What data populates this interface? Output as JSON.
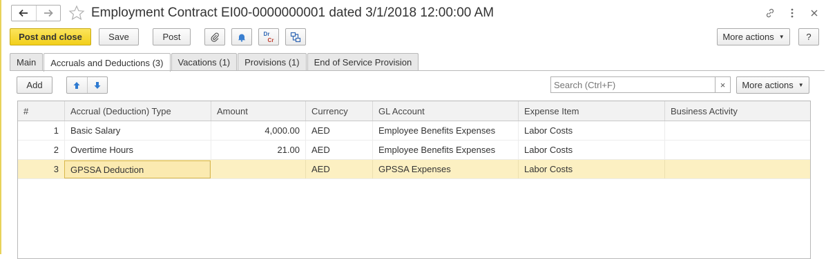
{
  "window": {
    "title": "Employment Contract EI00-0000000001 dated 3/1/2018 12:00:00 AM"
  },
  "toolbar": {
    "post_and_close": "Post and close",
    "save": "Save",
    "post": "Post",
    "more_actions": "More actions",
    "help": "?",
    "dr_label": "Dr",
    "cr_label": "Cr"
  },
  "tabs": [
    {
      "label": "Main"
    },
    {
      "label": "Accruals and Deductions (3)"
    },
    {
      "label": "Vacations (1)"
    },
    {
      "label": "Provisions (1)"
    },
    {
      "label": "End of Service Provision"
    }
  ],
  "panel": {
    "add": "Add",
    "search_placeholder": "Search (Ctrl+F)",
    "clear": "×",
    "more_actions": "More actions"
  },
  "table": {
    "columns": [
      "#",
      "Accrual (Deduction) Type",
      "Amount",
      "Currency",
      "GL Account",
      "Expense Item",
      "Business Activity"
    ],
    "rows": [
      {
        "n": "1",
        "type": "Basic Salary",
        "amount": "4,000.00",
        "currency": "AED",
        "gl": "Employee Benefits Expenses",
        "expense": "Labor Costs",
        "activity": ""
      },
      {
        "n": "2",
        "type": "Overtime Hours",
        "amount": "21.00",
        "currency": "AED",
        "gl": "Employee Benefits Expenses",
        "expense": "Labor Costs",
        "activity": ""
      },
      {
        "n": "3",
        "type": "GPSSA Deduction",
        "amount": "",
        "currency": "AED",
        "gl": "GPSSA Expenses",
        "expense": "Labor Costs",
        "activity": ""
      }
    ]
  },
  "colors": {
    "primary_button": "#f2cf1a",
    "selected_row": "#fcf0c2",
    "arrow_blue": "#2f7bd1"
  }
}
